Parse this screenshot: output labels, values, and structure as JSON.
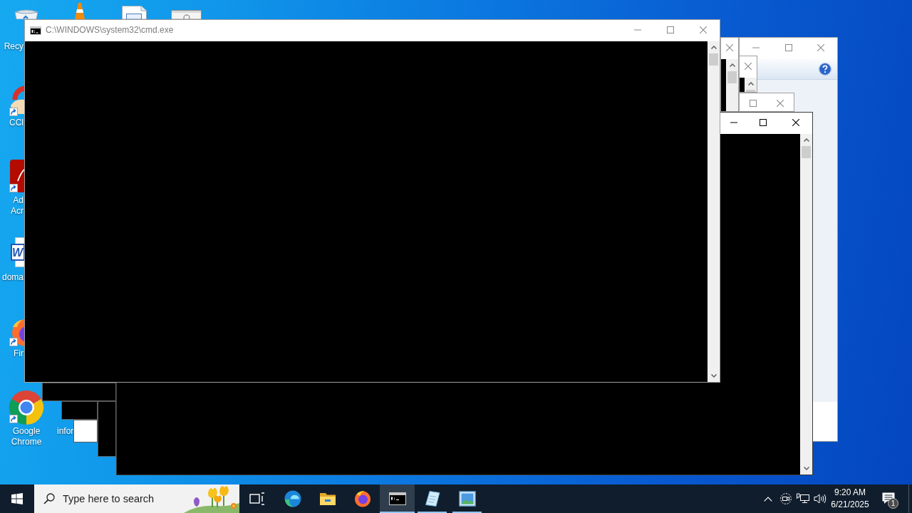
{
  "desktop_icons": [
    {
      "kind": "bin",
      "shortcut": false,
      "lines": [
        "Recy"
      ]
    },
    {
      "kind": "cone"
    },
    {
      "kind": "document"
    },
    {
      "kind": "window"
    },
    {
      "kind": "cleaner",
      "shortcut": true,
      "lines": [
        "CCl"
      ]
    },
    {
      "kind": "pdf",
      "shortcut": true,
      "lines": [
        "Ad",
        "Acr"
      ]
    },
    {
      "kind": "word",
      "shortcut": false,
      "glyph": "W",
      "lines": [
        "doma"
      ]
    },
    {
      "kind": "fox",
      "shortcut": true,
      "lines": [
        "Fir"
      ]
    },
    {
      "kind": "chrome",
      "shortcut": true,
      "lines": [
        "Google",
        "Chrome"
      ]
    },
    {
      "lines": [
        "infor"
      ]
    }
  ],
  "windows": [
    {
      "kind": "dialog",
      "active": false,
      "buttons": [
        {
          "kind": "minimize"
        },
        {
          "kind": "maximize"
        },
        {
          "kind": "close"
        }
      ]
    },
    {
      "kind": "console",
      "active": false,
      "buttons": [
        {
          "kind": "close"
        }
      ],
      "scrollbar": true
    },
    {
      "kind": "console",
      "active": false,
      "buttons": [
        {
          "kind": "maximize"
        },
        {
          "kind": "close"
        }
      ],
      "scrollbar": false
    },
    {
      "kind": "console",
      "active": false,
      "buttons": [
        {
          "kind": "close"
        }
      ],
      "scrollbar": true
    },
    {
      "kind": "fragment",
      "dark": true
    },
    {
      "kind": "fragment",
      "dark": true
    },
    {
      "kind": "fragment",
      "dark": true
    },
    {
      "kind": "fragment",
      "dark": false
    },
    {
      "kind": "console",
      "active": true,
      "buttons": [
        {
          "kind": "minimize"
        },
        {
          "kind": "maximize"
        },
        {
          "kind": "close"
        }
      ],
      "scrollbar": true
    },
    {
      "kind": "console",
      "active": false,
      "title": "C:\\WINDOWS\\system32\\cmd.exe",
      "buttons": [
        {
          "kind": "minimize"
        },
        {
          "kind": "maximize"
        },
        {
          "kind": "close"
        }
      ],
      "scrollbar": true
    }
  ],
  "taskbar": {
    "search": {
      "placeholder": "Type here to search"
    },
    "apps": [
      {
        "kind": "taskview",
        "running": false,
        "selected": false
      },
      {
        "kind": "swirl",
        "running": false,
        "selected": false
      },
      {
        "kind": "folder",
        "running": false,
        "selected": false
      },
      {
        "kind": "fox",
        "running": false,
        "selected": false
      },
      {
        "kind": "console",
        "running": true,
        "selected": true
      },
      {
        "kind": "notepad",
        "running": true,
        "selected": false
      },
      {
        "kind": "pictures",
        "running": true,
        "selected": false
      }
    ],
    "clock": {
      "time": "9:20 AM",
      "date": "6/21/2025"
    },
    "notifications": {
      "count": "1"
    }
  }
}
